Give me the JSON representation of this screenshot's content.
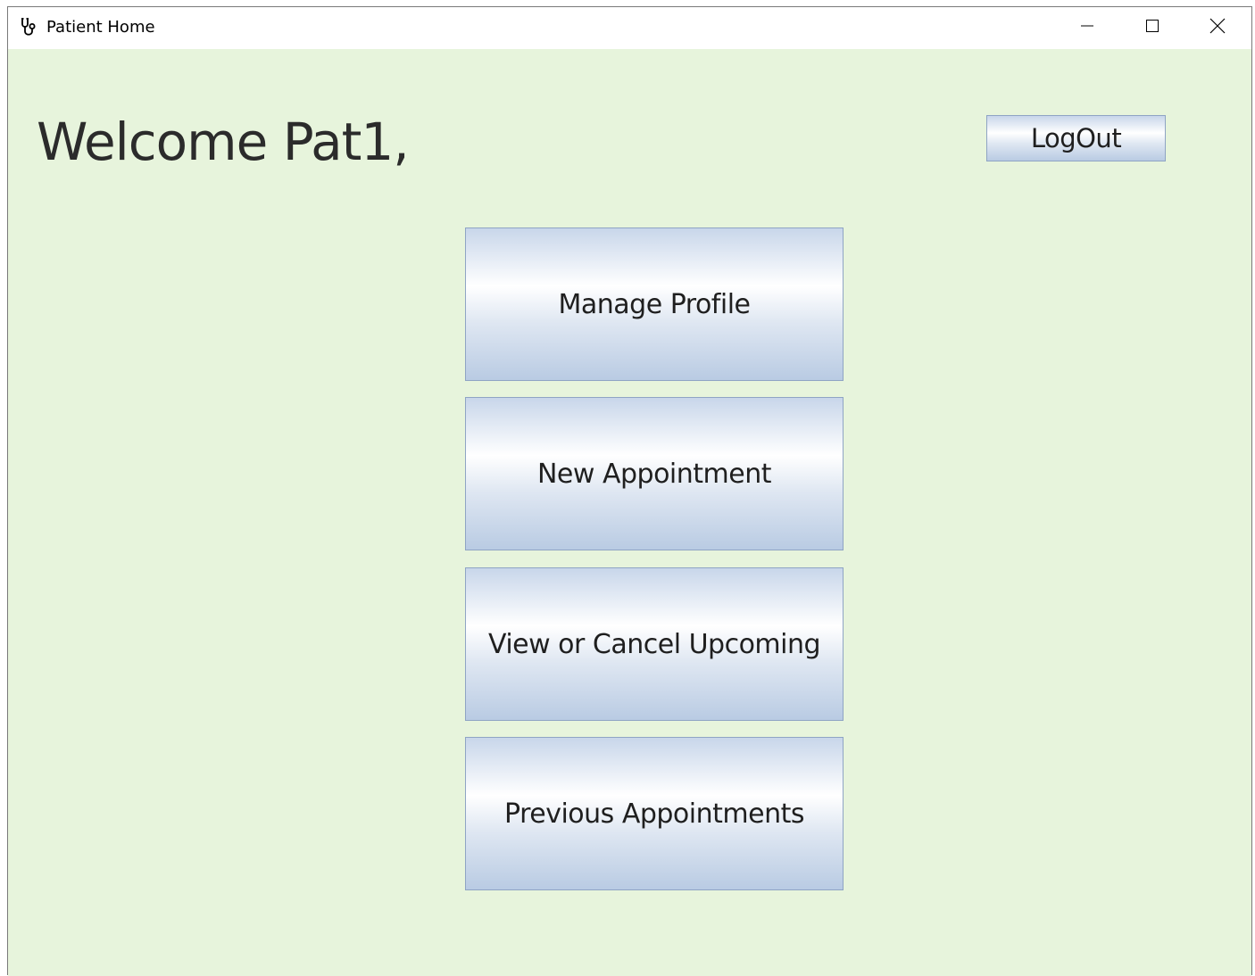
{
  "window": {
    "title": "Patient Home",
    "icon": "stethoscope-icon",
    "controls": {
      "minimize_icon": "minimize-icon",
      "maximize_icon": "maximize-icon",
      "close_icon": "close-icon"
    }
  },
  "header": {
    "welcome_text": "Welcome Pat1,",
    "logout_label": "LogOut"
  },
  "menu": {
    "manage_profile_label": "Manage Profile",
    "new_appointment_label": "New Appointment",
    "view_cancel_label": "View or Cancel Upcoming",
    "previous_appointments_label": "Previous Appointments"
  },
  "colors": {
    "background": "#e7f4dc",
    "button_border": "#8fa4c4",
    "button_gradient_top": "#ffffff",
    "button_gradient_bottom": "#b9cbe3",
    "text": "#2b2b2b"
  }
}
